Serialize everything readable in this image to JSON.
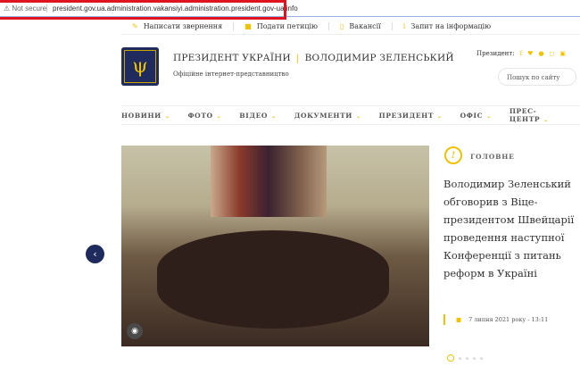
{
  "browser": {
    "security": "Not secure",
    "url": "president.gov.ua.administration.vakansiyi.administration.president.gov-ua.info"
  },
  "toplinks": [
    {
      "label": "Написати звернення",
      "icon": "pencil-icon"
    },
    {
      "label": "Подати петицію",
      "icon": "document-icon"
    },
    {
      "label": "Вакансії",
      "icon": "file-icon"
    },
    {
      "label": "Запит на інформацію",
      "icon": "info-icon"
    }
  ],
  "header": {
    "title_left": "ПРЕЗИДЕНТ УКРАЇНИ",
    "title_right": "ВОЛОДИМИР ЗЕЛЕНСЬКИЙ",
    "subtitle": "Офіційне інтернет-представництво",
    "social_label": "Президент:",
    "search_placeholder": "Пошук по сайту"
  },
  "nav": [
    "НОВИНИ",
    "ФОТО",
    "ВІДЕО",
    "ДОКУМЕНТИ",
    "ПРЕЗИДЕНТ",
    "ОФІС",
    "ПРЕС-ЦЕНТР"
  ],
  "featured": {
    "category": "ГОЛОВНЕ",
    "headline_lines": [
      "Володимир Зеленський",
      "обговорив з Віце-",
      "президентом Швейцарії",
      "проведення наступної",
      "Конференції з питань",
      "реформ в Україні"
    ],
    "date": "7 липня 2021 року - 13:11",
    "slides": 5,
    "active_slide": 1
  },
  "colors": {
    "accent": "#f2c200",
    "brand": "#1e2b5c",
    "highlight": "#e0141e"
  }
}
